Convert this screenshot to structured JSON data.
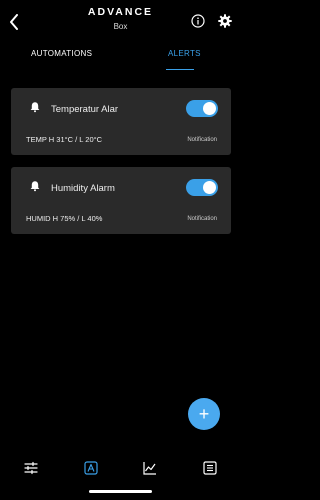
{
  "header": {
    "title": "ADVANCE",
    "subtitle": "Box",
    "icons": [
      "back-chevron-icon",
      "info-icon",
      "gear-icon"
    ]
  },
  "tabs": {
    "automations": "AUTOMATIONS",
    "alerts": "ALERTS",
    "active": "alerts"
  },
  "alerts": [
    {
      "name": "Temperatur Alar",
      "reading": "TEMP H 31°C / L 20°C",
      "type": "Notification",
      "enabled": true
    },
    {
      "name": "Humidity Alarm",
      "reading": "HUMID H 75% / L 40%",
      "type": "Notification",
      "enabled": true
    }
  ],
  "fab": {
    "label": "+"
  },
  "bottom_nav": {
    "items": [
      "sliders-icon",
      "automation-icon",
      "chart-icon",
      "list-icon"
    ],
    "active": 1
  },
  "colors": {
    "accent": "#3aa0e8",
    "card": "#2a2a2a",
    "background": "#000000"
  }
}
